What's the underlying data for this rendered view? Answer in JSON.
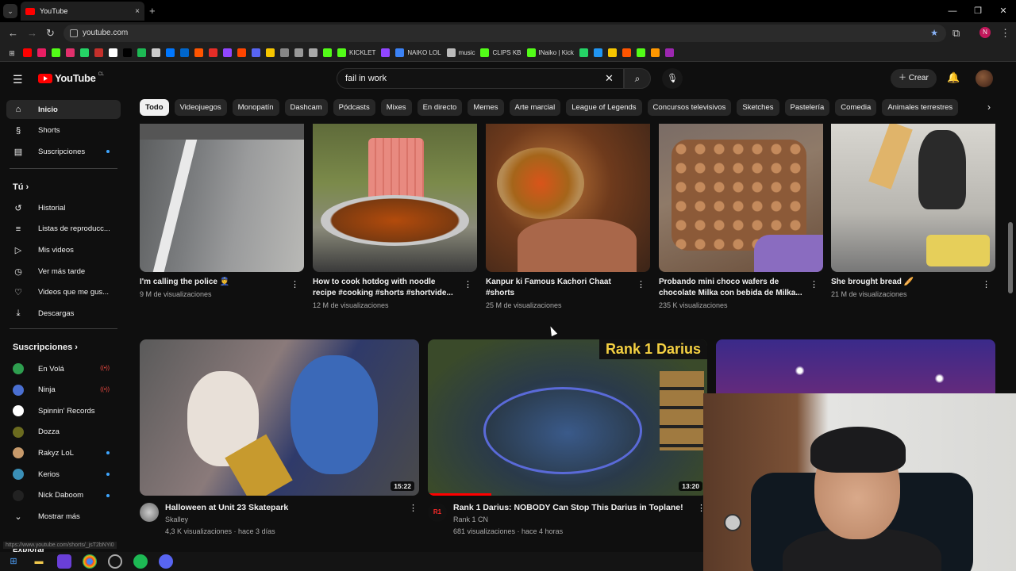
{
  "browser": {
    "tab_title": "YouTube",
    "tab_close": "×",
    "new_tab": "+",
    "url": "youtube.com",
    "window_controls": [
      "—",
      "❐",
      "✕"
    ],
    "profile_initial": "N",
    "bookmarks": [
      {
        "label": "",
        "color": "#ff0000"
      },
      {
        "label": "",
        "color": "#e91e63"
      },
      {
        "label": "",
        "color": "#53fc18"
      },
      {
        "label": "",
        "color": "#e1306c"
      },
      {
        "label": "",
        "color": "#25d366"
      },
      {
        "label": "",
        "color": "#c4302b"
      },
      {
        "label": "",
        "color": "#ffffff"
      },
      {
        "label": "",
        "color": "#010101"
      },
      {
        "label": "",
        "color": "#1db954"
      },
      {
        "label": "",
        "color": "#cccccc"
      },
      {
        "label": "",
        "color": "#0077ff"
      },
      {
        "label": "",
        "color": "#0066cc"
      },
      {
        "label": "",
        "color": "#ff5500"
      },
      {
        "label": "",
        "color": "#e52d27"
      },
      {
        "label": "",
        "color": "#9146ff"
      },
      {
        "label": "",
        "color": "#ff4500"
      },
      {
        "label": "",
        "color": "#5865f2"
      },
      {
        "label": "",
        "color": "#f7c600"
      },
      {
        "label": "",
        "color": "#888888"
      },
      {
        "label": "",
        "color": "#999999"
      },
      {
        "label": "",
        "color": "#aaaaaa"
      },
      {
        "label": "",
        "color": "#53fc18"
      },
      {
        "label": "KICKLET",
        "color": "#53fc18"
      },
      {
        "label": "",
        "color": "#9146ff"
      },
      {
        "label": "NAIKO LOL",
        "color": "#3b82f6"
      },
      {
        "label": "music",
        "color": "#bbbbbb"
      },
      {
        "label": "CLIPS KB",
        "color": "#53fc18"
      },
      {
        "label": "INaiko | Kick",
        "color": "#53fc18"
      },
      {
        "label": "",
        "color": "#25d366"
      },
      {
        "label": "",
        "color": "#2196f3"
      },
      {
        "label": "",
        "color": "#f7c600"
      },
      {
        "label": "",
        "color": "#ff5500"
      },
      {
        "label": "",
        "color": "#53fc18"
      },
      {
        "label": "",
        "color": "#ff9800"
      },
      {
        "label": "",
        "color": "#9c27b0"
      }
    ]
  },
  "header": {
    "logo_text": "YouTube",
    "country": "CL",
    "search_value": "fail in work",
    "create_label": "Crear"
  },
  "sidebar": {
    "main": [
      {
        "label": "Inicio",
        "icon": "home-icon",
        "glyph": "⌂",
        "active": true
      },
      {
        "label": "Shorts",
        "icon": "shorts-icon",
        "glyph": "§",
        "active": false
      },
      {
        "label": "Suscripciones",
        "icon": "subscriptions-icon",
        "glyph": "▤",
        "active": false
      }
    ],
    "you_title": "Tú",
    "you": [
      {
        "label": "Historial",
        "icon": "history-icon",
        "glyph": "↺"
      },
      {
        "label": "Listas de reproducc...",
        "icon": "playlists-icon",
        "glyph": "≡"
      },
      {
        "label": "Mis videos",
        "icon": "my-videos-icon",
        "glyph": "▷"
      },
      {
        "label": "Ver más tarde",
        "icon": "watch-later-icon",
        "glyph": "◷"
      },
      {
        "label": "Videos que me gus...",
        "icon": "liked-icon",
        "glyph": "♡"
      },
      {
        "label": "Descargas",
        "icon": "downloads-icon",
        "glyph": "⤓"
      }
    ],
    "subs_title": "Suscripciones",
    "subs": [
      {
        "label": "En Volá",
        "color": "#2e9e4f",
        "badge": "live"
      },
      {
        "label": "Ninja",
        "color": "#4a6fd1",
        "badge": "live"
      },
      {
        "label": "Spinnin' Records",
        "color": "#ffffff",
        "badge": "none"
      },
      {
        "label": "Dozza",
        "color": "#6b6b1f",
        "badge": "none"
      },
      {
        "label": "Rakyz LoL",
        "color": "#c79a6b",
        "badge": "dot"
      },
      {
        "label": "Kerios",
        "color": "#3a8fb7",
        "badge": "dot"
      },
      {
        "label": "Nick Daboom",
        "color": "#222222",
        "badge": "dot"
      }
    ],
    "show_more": "Mostrar más",
    "explore": "Explorar"
  },
  "chips": [
    "Todo",
    "Videojuegos",
    "Monopatín",
    "Dashcam",
    "Pódcasts",
    "Mixes",
    "En directo",
    "Memes",
    "Arte marcial",
    "League of Legends",
    "Concursos televisivos",
    "Sketches",
    "Pastelería",
    "Comedia",
    "Animales terrestres"
  ],
  "shorts": [
    {
      "title": "I'm calling the police 👮",
      "views": "9 M de visualizaciones"
    },
    {
      "title": "How to cook hotdog with noodle recipe #cooking #shorts #shortvide...",
      "views": "12 M de visualizaciones"
    },
    {
      "title": "Kanpur ki Famous Kachori Chaat #shorts",
      "views": "25 M de visualizaciones"
    },
    {
      "title": "Probando mini choco wafers de chocolate Milka con bebida de Milka...",
      "views": "235 K visualizaciones"
    },
    {
      "title": "She brought bread 🥖",
      "views": "21 M de visualizaciones"
    }
  ],
  "videos": [
    {
      "title": "Halloween at Unit 23 Skatepark",
      "channel": "Skalley",
      "meta": "4,3 K visualizaciones · hace 3 días",
      "duration": "15:22"
    },
    {
      "title": "Rank 1 Darius: NOBODY Can Stop This Darius in Toplane!",
      "channel": "Rank 1 CN",
      "meta": "681 visualizaciones · hace 4 horas",
      "duration": "13:20",
      "overlay": "Rank 1 Darius"
    },
    {
      "title": "",
      "channel": "",
      "meta": "",
      "duration": ""
    }
  ],
  "status_url": "https://www.youtube.com/shorts/_jsT2bNYi0"
}
